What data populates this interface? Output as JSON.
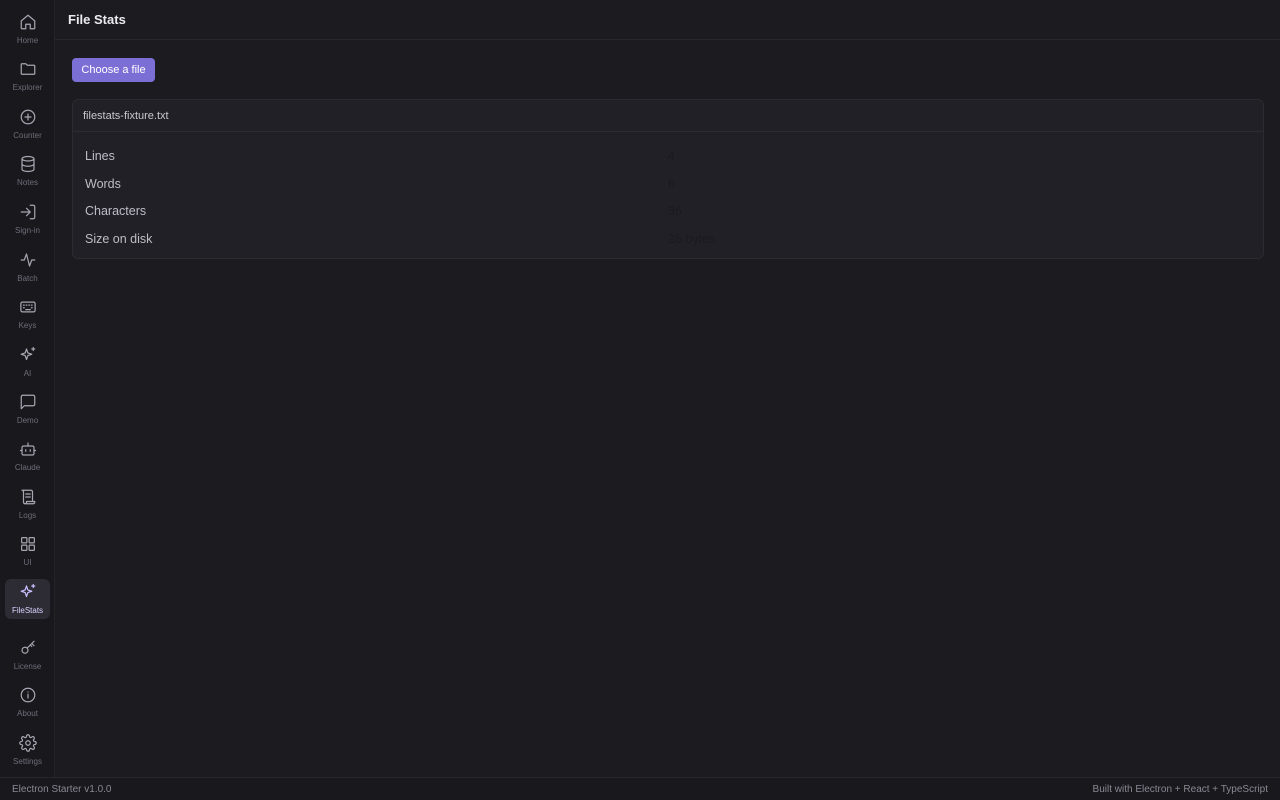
{
  "sidebar": {
    "items": [
      {
        "label": "Home",
        "icon": "home-icon"
      },
      {
        "label": "Explorer",
        "icon": "folder-icon"
      },
      {
        "label": "Counter",
        "icon": "plus-circle-icon"
      },
      {
        "label": "Notes",
        "icon": "database-icon"
      },
      {
        "label": "Sign-in",
        "icon": "sign-in-icon"
      },
      {
        "label": "Batch",
        "icon": "activity-icon"
      },
      {
        "label": "Keys",
        "icon": "keyboard-icon"
      },
      {
        "label": "AI",
        "icon": "sparkles-icon"
      },
      {
        "label": "Demo",
        "icon": "message-square-icon"
      },
      {
        "label": "Claude",
        "icon": "bot-icon"
      },
      {
        "label": "Logs",
        "icon": "scroll-icon"
      },
      {
        "label": "UI",
        "icon": "grid-icon"
      },
      {
        "label": "FileStats",
        "icon": "sparkles-icon",
        "active": true
      },
      {
        "label": "License",
        "icon": "key-icon"
      },
      {
        "label": "About",
        "icon": "info-icon"
      },
      {
        "label": "Settings",
        "icon": "gear-icon"
      }
    ]
  },
  "header": {
    "title": "File Stats"
  },
  "main": {
    "choose_button": "Choose a file",
    "file": {
      "name": "filestats-fixture.txt",
      "stats": [
        {
          "label": "Lines",
          "value": "4"
        },
        {
          "label": "Words",
          "value": "6"
        },
        {
          "label": "Characters",
          "value": "36"
        },
        {
          "label": "Size on disk",
          "value": "36 bytes"
        }
      ]
    }
  },
  "footer": {
    "left": "Electron Starter v1.0.0",
    "right": "Built with Electron + React + TypeScript"
  },
  "colors": {
    "accent": "#7b6fd6",
    "background": "#1c1b20",
    "sidebar": "#19181d"
  }
}
